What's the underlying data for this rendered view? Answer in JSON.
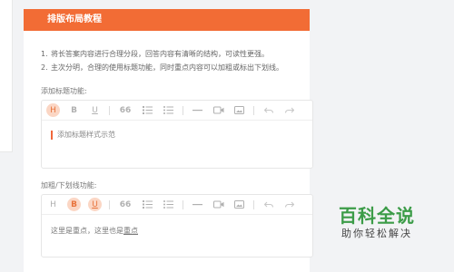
{
  "header": {
    "title": "排版布局教程"
  },
  "list": [
    {
      "num": "1.",
      "text": "将长答案内容进行合理分段，回答内容有清晰的结构，可读性更强。"
    },
    {
      "num": "2.",
      "text": "主次分明，合理的使用标题功能，同时重点内容可以加粗或标出下划线。"
    }
  ],
  "section1": {
    "label": "添加标题功能:",
    "content": "添加标题样式示范",
    "active": [
      "H"
    ]
  },
  "section2": {
    "label": "加粗/下划线功能:",
    "content_plain": "这里是重点，这里也是",
    "content_emph": "重点",
    "active": [
      "B",
      "U"
    ]
  },
  "toolbar": {
    "heading": "H",
    "bold": "B",
    "underline": "U",
    "quote": "66"
  },
  "watermark": {
    "title": "百科全说",
    "subtitle": "助你轻松解决"
  },
  "colors": {
    "accent": "#f26c35",
    "watermark_green": "#3c9c48"
  }
}
